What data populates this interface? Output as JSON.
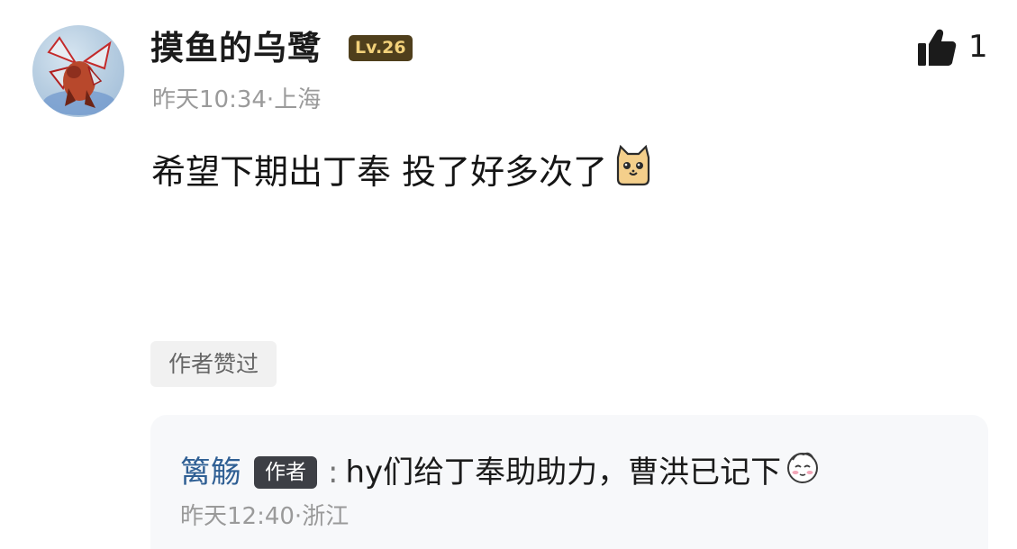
{
  "post": {
    "username": "摸鱼的乌鹭",
    "level": "Lv.26",
    "like_count": "1",
    "meta": "昨天10:34·上海",
    "content": "希望下期出丁奉 投了好多次了",
    "emoji": "cat-emoji",
    "author_liked_tag": "作者赞过"
  },
  "reply": {
    "username": "篱觞",
    "author_badge": "作者",
    "separator": ":",
    "content": "hy们给丁奉助助力，曹洪已记下",
    "emoji": "shy-face-emoji",
    "meta": "昨天12:40·浙江"
  },
  "colors": {
    "level_badge_bg": "#4f3f1c",
    "level_badge_text": "#f2d17a",
    "reply_name": "#2f5f94",
    "meta_text": "#9a9a9a"
  }
}
